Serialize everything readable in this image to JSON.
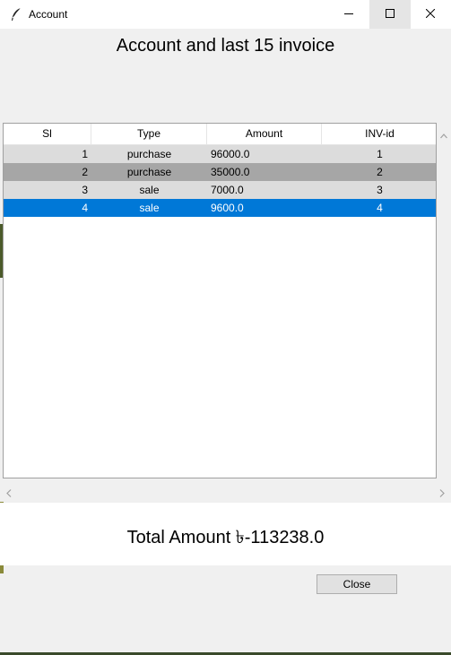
{
  "window": {
    "title": "Account",
    "minimize_icon": "minimize-icon",
    "maximize_icon": "maximize-icon",
    "close_icon": "close-icon"
  },
  "heading": "Account and last 15 invoice",
  "table": {
    "columns": [
      "Sl",
      "Type",
      "Amount",
      "INV-id"
    ],
    "rows": [
      {
        "sl": "1",
        "type": "purchase",
        "amount": "96000.0",
        "inv": "1"
      },
      {
        "sl": "2",
        "type": "purchase",
        "amount": "35000.0",
        "inv": "2"
      },
      {
        "sl": "3",
        "type": "sale",
        "amount": "7000.0",
        "inv": "3"
      },
      {
        "sl": "4",
        "type": "sale",
        "amount": "9600.0",
        "inv": "4"
      }
    ],
    "row_colors": [
      "#dcdcdc",
      "#a6a6a6",
      "#dcdcdc",
      "#0078d7"
    ],
    "selected_row": 4
  },
  "total": "Total Amount ৳-113238.0",
  "close_button": "Close"
}
